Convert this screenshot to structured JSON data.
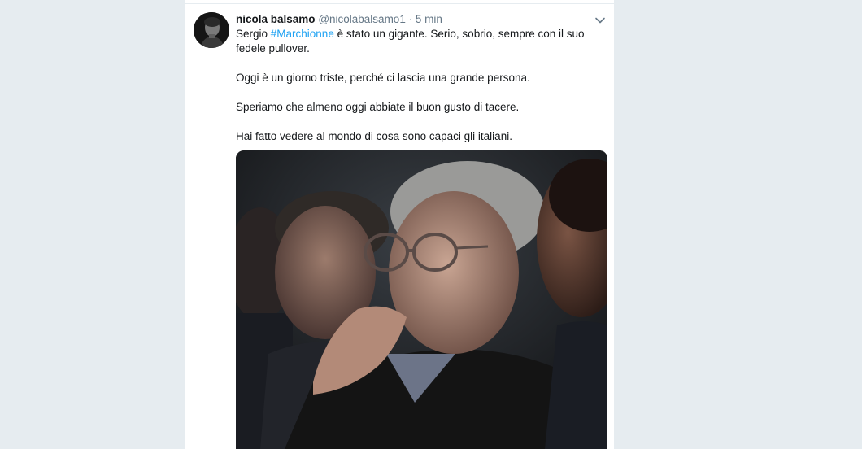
{
  "tweet": {
    "author_name": "nicola balsamo",
    "author_handle": "@nicolabalsamo1",
    "separator": "·",
    "time": "5 min",
    "line1_prefix": "Sergio ",
    "hashtag": "#Marchionne",
    "line1_suffix": " è stato un gigante. Serio, sobrio, sempre con il suo fedele pullover.",
    "paragraph2": "Oggi è un giorno triste, perché ci lascia una grande persona.",
    "paragraph3": "Speriamo che almeno oggi abbiate il buon gusto di tacere.",
    "paragraph4": "Hai fatto vedere al mondo di cosa sono capaci gli italiani.",
    "menu_icon": "chevron-down-icon",
    "hashtag_color": "#1da1f2"
  }
}
